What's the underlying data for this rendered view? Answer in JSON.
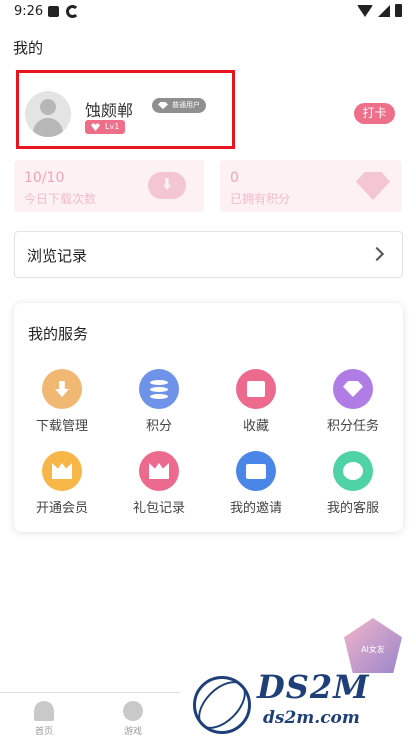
{
  "status_bar": {
    "time": "9:26"
  },
  "page": {
    "title": "我的"
  },
  "profile": {
    "username": "蚀颇郸",
    "user_type": "普通用户",
    "level": "Lv1",
    "checkin_label": "打卡"
  },
  "stats": [
    {
      "value": "10/10",
      "label": "今日下载次数"
    },
    {
      "value": "0",
      "label": "已拥有积分"
    }
  ],
  "history": {
    "label": "浏览记录"
  },
  "services": {
    "heading": "我的服务",
    "items": [
      {
        "label": "下载管理",
        "icon": "download-icon",
        "color": "#f1b874"
      },
      {
        "label": "积分",
        "icon": "coins-icon",
        "color": "#6f93e8"
      },
      {
        "label": "收藏",
        "icon": "favorite-folder-icon",
        "color": "#ec6a8d"
      },
      {
        "label": "积分任务",
        "icon": "gem-icon",
        "color": "#b07de6"
      },
      {
        "label": "开通会员",
        "icon": "crown-icon",
        "color": "#f7b648"
      },
      {
        "label": "礼包记录",
        "icon": "gift-crown-icon",
        "color": "#ec6a8d"
      },
      {
        "label": "我的邀请",
        "icon": "invite-envelope-icon",
        "color": "#4a86e8"
      },
      {
        "label": "我的客服",
        "icon": "chat-bubble-icon",
        "color": "#4fd2a6"
      }
    ]
  },
  "tabbar": [
    {
      "label": "首页",
      "icon": "ghost-home-icon"
    },
    {
      "label": "游戏",
      "icon": "gamepad-icon"
    }
  ],
  "watermark": {
    "brand": "DS2M",
    "domain": "ds2m.com",
    "badge": "AI女友"
  }
}
